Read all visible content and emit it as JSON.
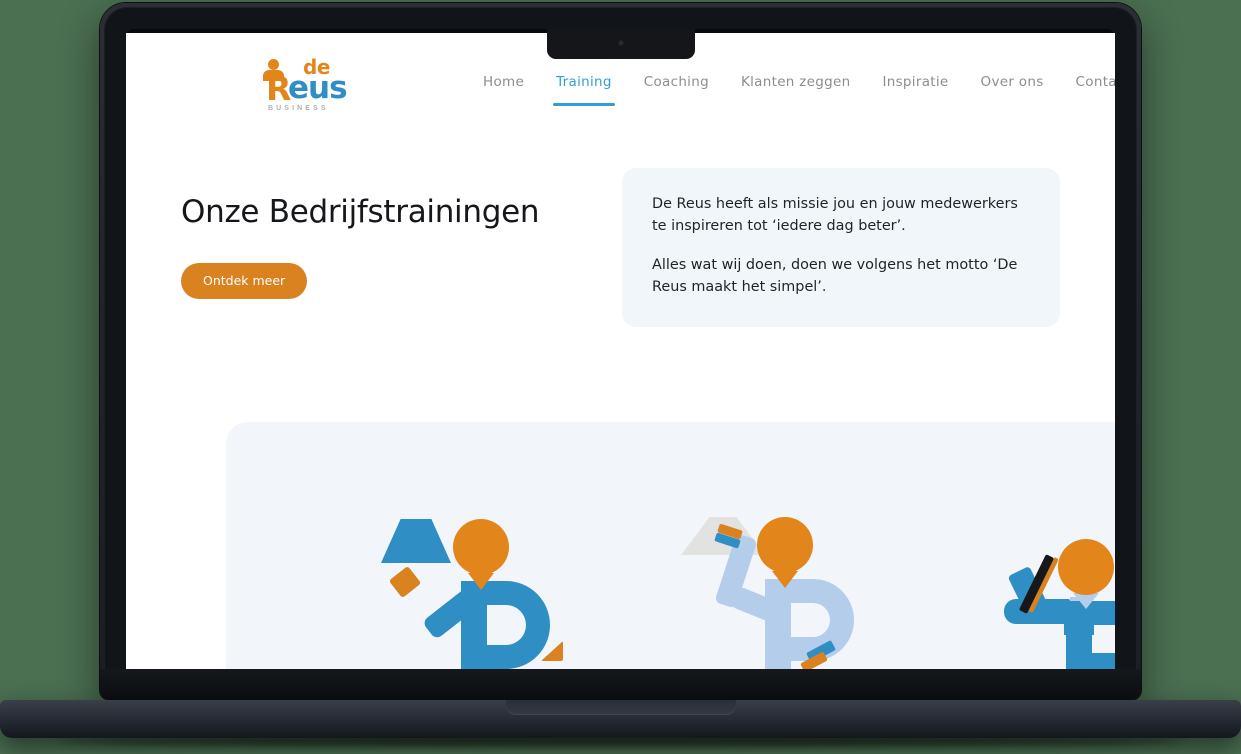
{
  "site": {
    "logo": {
      "de": "de",
      "r": "R",
      "eus": "eus",
      "tagline": "BUSINESS"
    },
    "nav": [
      {
        "label": "Home",
        "active": false
      },
      {
        "label": "Training",
        "active": true
      },
      {
        "label": "Coaching",
        "active": false
      },
      {
        "label": "Klanten zeggen",
        "active": false
      },
      {
        "label": "Inspiratie",
        "active": false
      },
      {
        "label": "Over ons",
        "active": false
      },
      {
        "label": "Contact",
        "active": false
      }
    ]
  },
  "hero": {
    "title": "Onze Bedrijfstrainingen",
    "cta_label": "Ontdek meer",
    "card": {
      "paragraph_1": "De Reus heeft als missie jou en jouw medewerkers te inspireren tot ‘iedere dag beter’.",
      "paragraph_2": "Alles wat wij doen, doen we volgens het motto ‘De Reus maakt het simpel’."
    }
  },
  "colors": {
    "page_background": "#4a6f51",
    "accent_orange": "#d9821f",
    "accent_blue": "#2f9fd8",
    "logo_blue": "#2f8ec4",
    "card_background": "#f1f6fb",
    "panel_background": "#f2f6fb",
    "nav_inactive": "#8d8d8d",
    "heading": "#15171a"
  },
  "illustration": {
    "figures": [
      {
        "name": "figure-waving-orange-object",
        "body_color": "#2f8ec4",
        "head_color": "#e2861c"
      },
      {
        "name": "figure-arm-raised",
        "body_color": "#b4cdeb",
        "head_color": "#e2861c"
      },
      {
        "name": "figure-holding-stick",
        "body_color": "#2f8ec4",
        "head_color": "#e2861c"
      }
    ]
  }
}
